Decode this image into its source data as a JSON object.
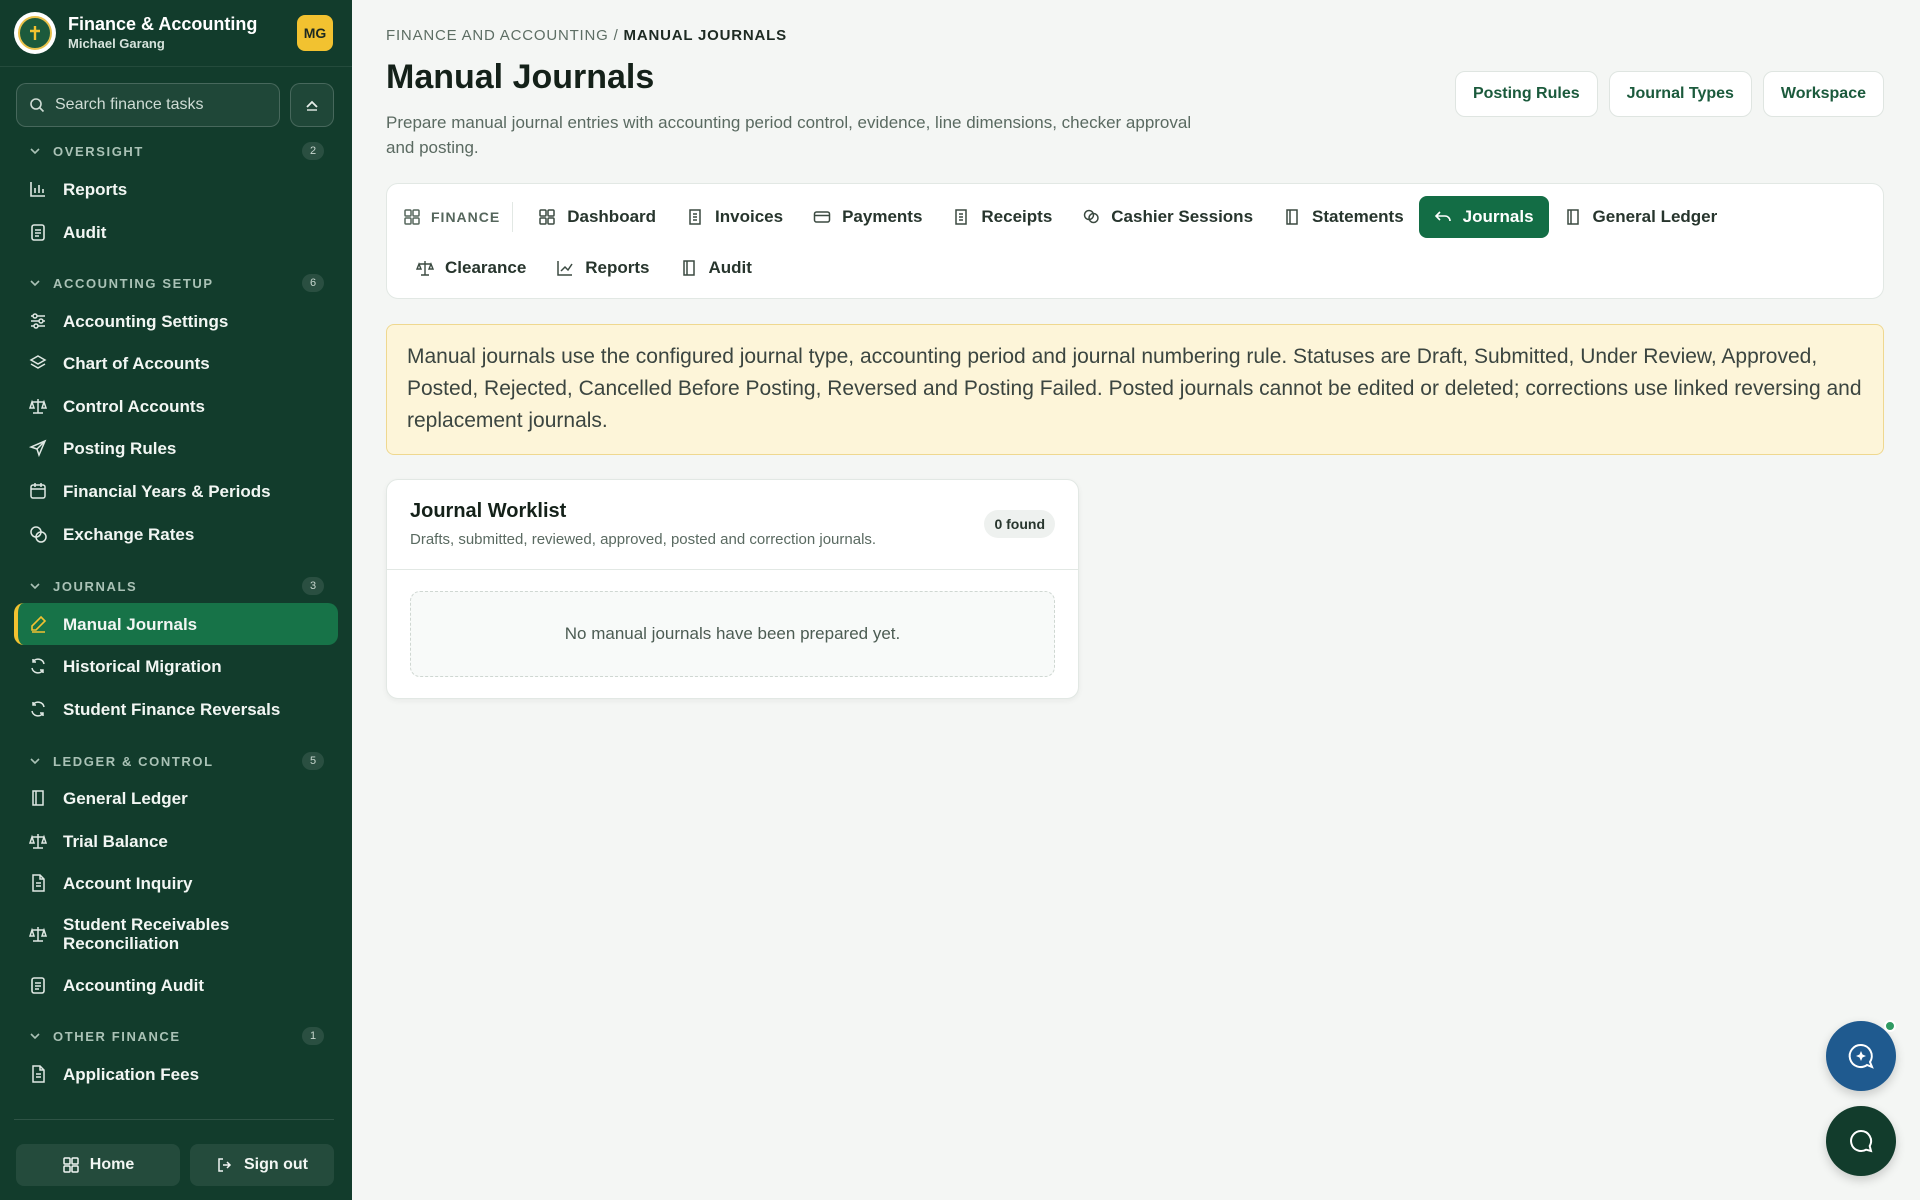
{
  "app": {
    "title": "Finance & Accounting",
    "user": "Michael Garang",
    "avatar_initials": "MG"
  },
  "search": {
    "placeholder": "Search finance tasks"
  },
  "sidebar": {
    "groups": [
      {
        "title": "OVERSIGHT",
        "count": "2",
        "items": [
          {
            "label": "Reports",
            "icon": "bar-chart-icon"
          },
          {
            "label": "Audit",
            "icon": "clipboard-icon"
          }
        ]
      },
      {
        "title": "ACCOUNTING SETUP",
        "count": "6",
        "items": [
          {
            "label": "Accounting Settings",
            "icon": "sliders-icon"
          },
          {
            "label": "Chart of Accounts",
            "icon": "layers-icon"
          },
          {
            "label": "Control Accounts",
            "icon": "scale-icon"
          },
          {
            "label": "Posting Rules",
            "icon": "send-icon"
          },
          {
            "label": "Financial Years & Periods",
            "icon": "calendar-icon"
          },
          {
            "label": "Exchange Rates",
            "icon": "coins-icon"
          }
        ]
      },
      {
        "title": "JOURNALS",
        "count": "3",
        "items": [
          {
            "label": "Manual Journals",
            "icon": "pencil-icon",
            "active": true
          },
          {
            "label": "Historical Migration",
            "icon": "refresh-icon"
          },
          {
            "label": "Student Finance Reversals",
            "icon": "refresh-icon"
          }
        ]
      },
      {
        "title": "LEDGER & CONTROL",
        "count": "5",
        "items": [
          {
            "label": "General Ledger",
            "icon": "book-icon"
          },
          {
            "label": "Trial Balance",
            "icon": "scale-icon"
          },
          {
            "label": "Account Inquiry",
            "icon": "file-text-icon"
          },
          {
            "label": "Student Receivables Reconciliation",
            "icon": "scale-icon"
          },
          {
            "label": "Accounting Audit",
            "icon": "clipboard-icon"
          }
        ]
      },
      {
        "title": "OTHER FINANCE",
        "count": "1",
        "items": [
          {
            "label": "Application Fees",
            "icon": "file-text-icon"
          }
        ]
      }
    ],
    "footer": {
      "home": "Home",
      "signout": "Sign out"
    }
  },
  "main": {
    "breadcrumb": {
      "parent": "FINANCE AND ACCOUNTING",
      "separator": " / ",
      "current": "MANUAL JOURNALS"
    },
    "title": "Manual Journals",
    "description": "Prepare manual journal entries with accounting period control, evidence, line dimensions, checker approval and posting.",
    "actions": [
      "Posting Rules",
      "Journal Types",
      "Workspace"
    ],
    "tabs_label": "FINANCE",
    "tabs": [
      {
        "label": "Dashboard",
        "icon": "grid-icon"
      },
      {
        "label": "Invoices",
        "icon": "receipt-icon"
      },
      {
        "label": "Payments",
        "icon": "credit-card-icon"
      },
      {
        "label": "Receipts",
        "icon": "receipt-icon"
      },
      {
        "label": "Cashier Sessions",
        "icon": "coins-icon"
      },
      {
        "label": "Statements",
        "icon": "book-icon"
      },
      {
        "label": "Journals",
        "icon": "undo-icon",
        "active": true
      },
      {
        "label": "General Ledger",
        "icon": "book-icon"
      },
      {
        "label": "Clearance",
        "icon": "scale-icon"
      },
      {
        "label": "Reports",
        "icon": "line-chart-icon"
      },
      {
        "label": "Audit",
        "icon": "book-icon"
      }
    ],
    "notice": "Manual journals use the configured journal type, accounting period and journal numbering rule. Statuses are Draft, Submitted, Under Review, Approved, Posted, Rejected, Cancelled Before Posting, Reversed and Posting Failed. Posted journals cannot be edited or deleted; corrections use linked reversing and replacement journals.",
    "worklist": {
      "title": "Journal Worklist",
      "subtitle": "Drafts, submitted, reviewed, approved, posted and correction journals.",
      "count": "0 found",
      "empty": "No manual journals have been prepared yet."
    }
  },
  "colors": {
    "sidebar": "#123c2c",
    "accent": "#136d45",
    "highlight": "#f2c230",
    "notice_bg": "#fdf5d9"
  }
}
